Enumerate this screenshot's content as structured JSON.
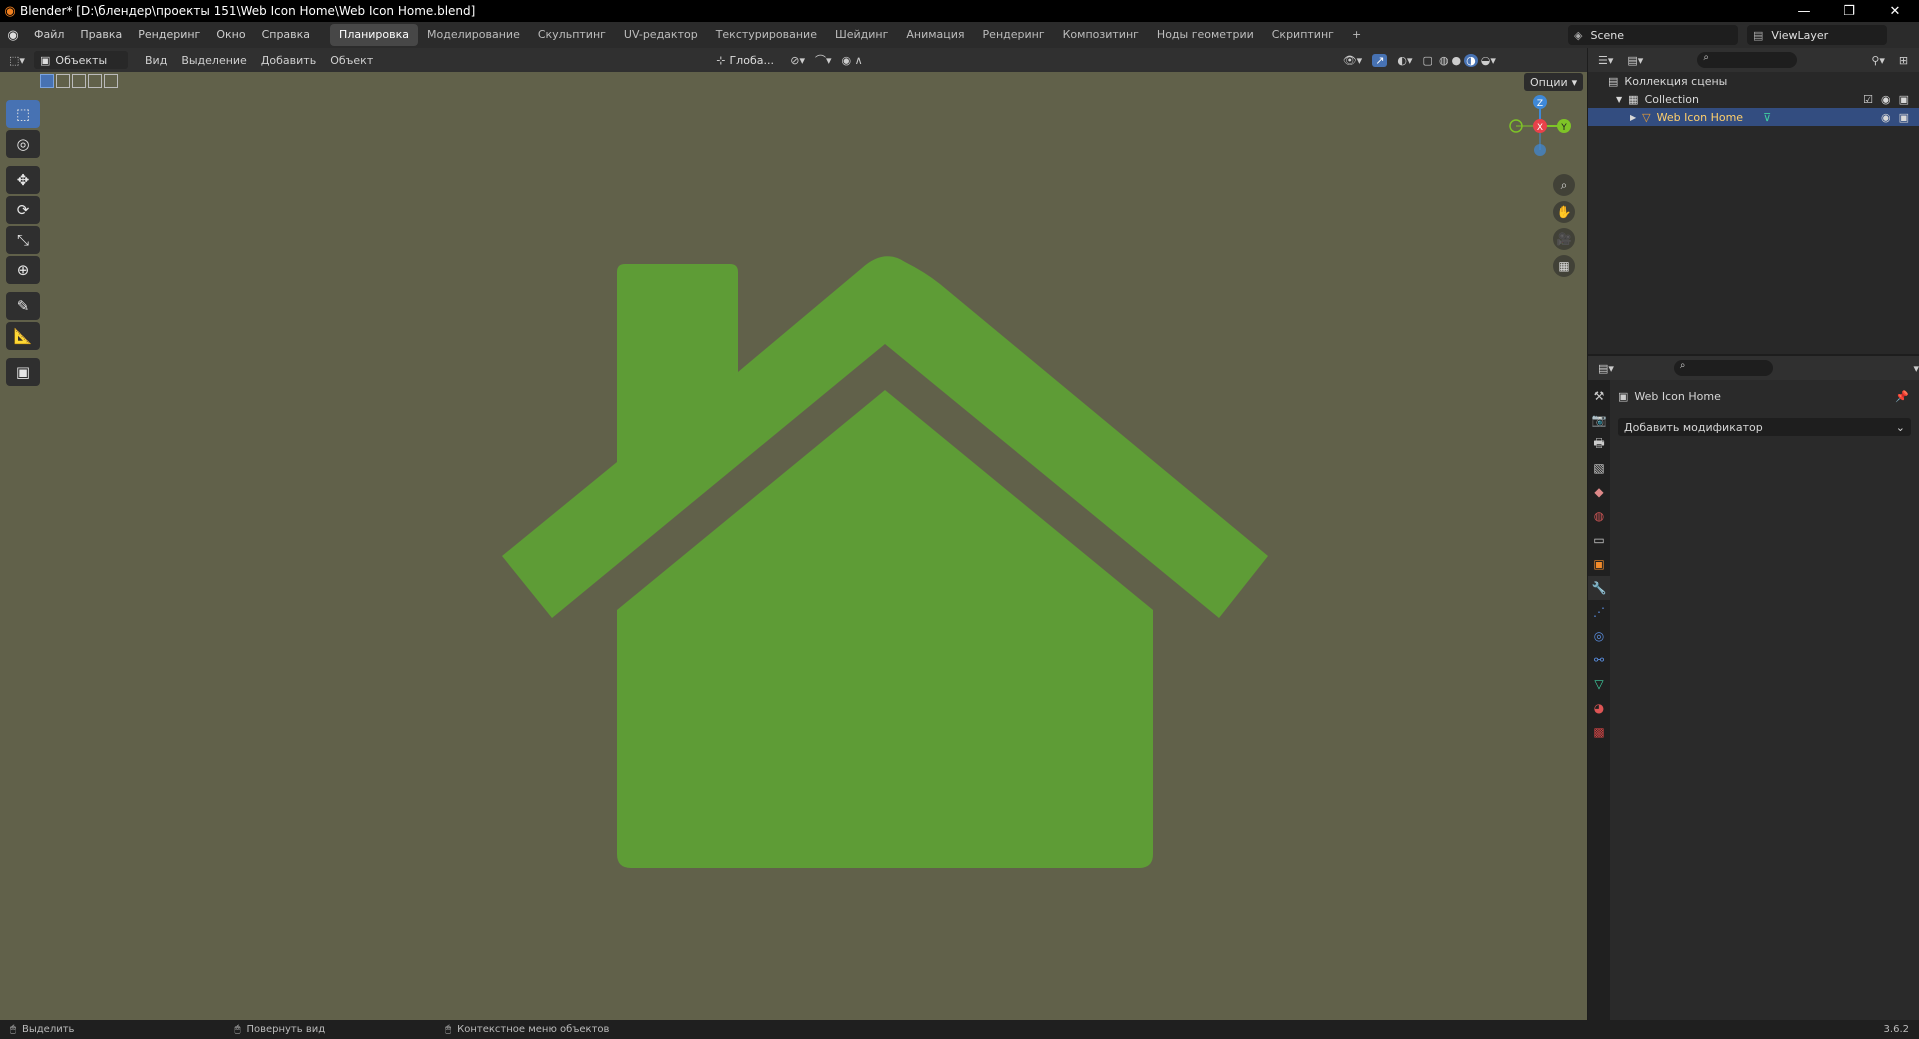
{
  "window": {
    "title": "Blender* [D:\\блендер\\проекты 151\\Web Icon Home\\Web Icon Home.blend]",
    "minimize": "—",
    "maximize": "❐",
    "close": "✕"
  },
  "menu": {
    "items": [
      "Файл",
      "Правка",
      "Рендеринг",
      "Окно",
      "Справка"
    ]
  },
  "workspaces": {
    "tabs": [
      "Планировка",
      "Моделирование",
      "Скульптинг",
      "UV-редактор",
      "Текстурирование",
      "Шейдинг",
      "Анимация",
      "Рендеринг",
      "Композитинг",
      "Ноды геометрии",
      "Скриптинг"
    ],
    "active": "Планировка",
    "add": "+"
  },
  "scene": {
    "name": "Scene",
    "view_layer": "ViewLayer"
  },
  "viewport_header": {
    "mode": "Объекты",
    "menus": [
      "Вид",
      "Выделение",
      "Добавить",
      "Объект"
    ],
    "orientation": "Глоба...",
    "options": "Опции"
  },
  "gizmo": {
    "x": "X",
    "y": "Y",
    "z": "Z"
  },
  "viewport": {
    "background": "#61614a",
    "object_color": "#5e9c36"
  },
  "outliner": {
    "root": "Коллекция сцены",
    "collection": "Collection",
    "object": "Web Icon Home"
  },
  "properties": {
    "object_name": "Web Icon Home",
    "add_modifier": "Добавить модификатор"
  },
  "statusbar": {
    "select": "Выделить",
    "rotate": "Повернуть вид",
    "context": "Контекстное меню объектов",
    "version": "3.6.2"
  },
  "colors": {
    "accent": "#4772b3",
    "axis_x": "#e8414a",
    "axis_y": "#7ec427",
    "axis_z": "#3f89d8"
  }
}
